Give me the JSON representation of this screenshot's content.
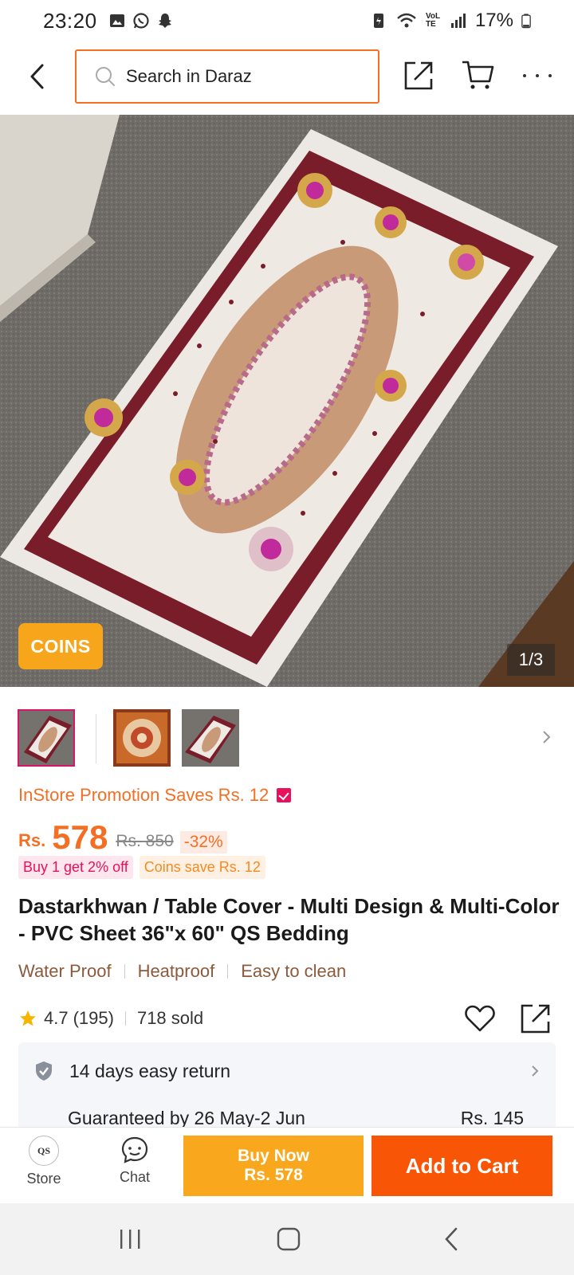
{
  "status_bar": {
    "time": "23:20",
    "battery": "17%",
    "network_label": "VoLTE"
  },
  "search": {
    "placeholder": "Search in Daraz"
  },
  "gallery": {
    "badge": "COINS",
    "counter": "1/3",
    "thumbnail_count": 3,
    "active_index": 0
  },
  "product": {
    "promo": "InStore Promotion Saves Rs. 12",
    "currency": "Rs.",
    "price": "578",
    "original_price": "Rs. 850",
    "discount": "-32%",
    "tags": [
      "Buy 1 get 2% off",
      "Coins save Rs. 12"
    ],
    "title": "Dastarkhwan / Table Cover - Multi Design & Multi-Color - PVC Sheet 36\"x 60\" QS Bedding",
    "features": [
      "Water Proof",
      "Heatproof",
      "Easy to clean"
    ],
    "rating": "4.7",
    "reviews": "(195)",
    "sold": "718 sold"
  },
  "services": {
    "return": "14 days easy return",
    "delivery": "Guaranteed by 26 May-2 Jun",
    "delivery_fee": "Rs. 145"
  },
  "bottom_bar": {
    "store_label": "Store",
    "store_logo_text": "QS",
    "chat_label": "Chat",
    "buy_now_label": "Buy Now",
    "buy_now_price": "Rs. 578",
    "add_to_cart_label": "Add to Cart"
  },
  "colors": {
    "accent": "#f36f24",
    "cart_button": "#f85606",
    "buy_button": "#f9a81d",
    "coins": "#f7a51b",
    "pink": "#e8125c"
  }
}
